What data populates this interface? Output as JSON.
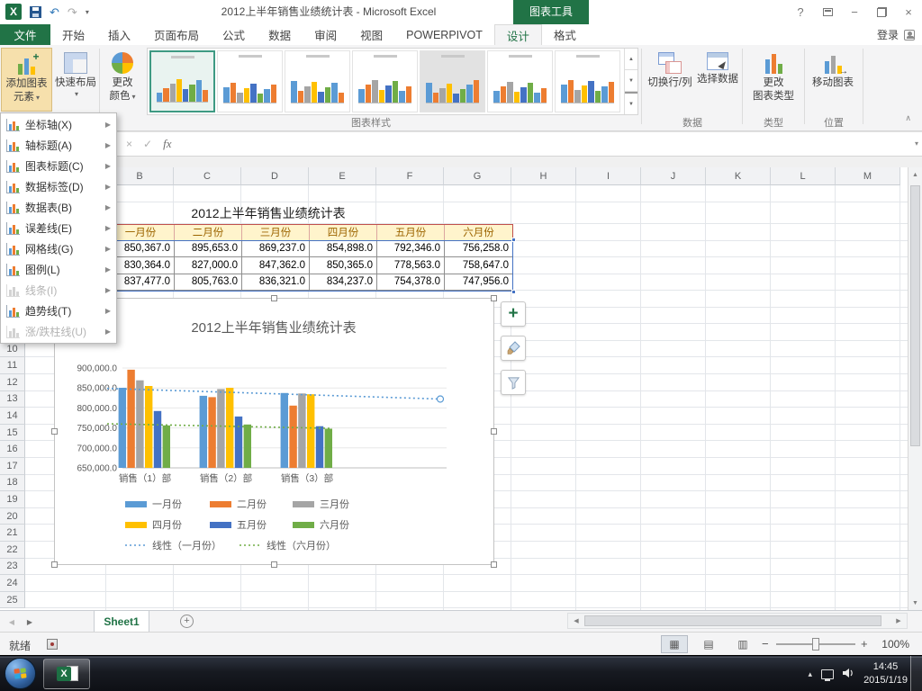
{
  "titlebar": {
    "app_title": "2012上半年销售业绩统计表 - Microsoft Excel",
    "context_tab_group": "图表工具"
  },
  "ribbon_tabs": {
    "file": "文件",
    "items": [
      "开始",
      "插入",
      "页面布局",
      "公式",
      "数据",
      "审阅",
      "视图",
      "POWERPIVOT",
      "设计",
      "格式"
    ],
    "active": "设计",
    "sign_in": "登录"
  },
  "ribbon": {
    "add_chart_element_line1": "添加图表",
    "add_chart_element_line2": "元素",
    "quick_layout": "快速布局",
    "change_colors_line1": "更改",
    "change_colors_line2": "颜色",
    "switch_row_col": "切换行/列",
    "select_data": "选择数据",
    "change_chart_type_line1": "更改",
    "change_chart_type_line2": "图表类型",
    "move_chart": "移动图表",
    "group_chart_styles": "图表样式",
    "group_data": "数据",
    "group_type": "类型",
    "group_position": "位置",
    "gallery": {
      "count": 7,
      "selected_index": 0
    }
  },
  "formula_bar": {
    "fx_label": "fx"
  },
  "menu": {
    "items": [
      {
        "label": "坐标轴(X)",
        "enabled": true,
        "icon": "axes-icon"
      },
      {
        "label": "轴标题(A)",
        "enabled": true,
        "icon": "axis-titles-icon"
      },
      {
        "label": "图表标题(C)",
        "enabled": true,
        "icon": "chart-title-icon"
      },
      {
        "label": "数据标签(D)",
        "enabled": true,
        "icon": "data-labels-icon"
      },
      {
        "label": "数据表(B)",
        "enabled": true,
        "icon": "data-table-icon"
      },
      {
        "label": "误差线(E)",
        "enabled": true,
        "icon": "error-bars-icon"
      },
      {
        "label": "网格线(G)",
        "enabled": true,
        "icon": "gridlines-icon"
      },
      {
        "label": "图例(L)",
        "enabled": true,
        "icon": "legend-icon"
      },
      {
        "label": "线条(I)",
        "enabled": false,
        "icon": "lines-icon"
      },
      {
        "label": "趋势线(T)",
        "enabled": true,
        "icon": "trendline-icon"
      },
      {
        "label": "涨/跌柱线(U)",
        "enabled": false,
        "icon": "updown-bars-icon"
      }
    ]
  },
  "sheet": {
    "columns": [
      "A",
      "B",
      "C",
      "D",
      "E",
      "F",
      "G",
      "H",
      "I",
      "J",
      "K",
      "L",
      "M"
    ],
    "row_count": 25,
    "table": {
      "title": "2012上半年销售业绩统计表",
      "month_headers": [
        "一月份",
        "二月份",
        "三月份",
        "四月份",
        "五月份",
        "六月份"
      ],
      "data_rows": [
        [
          "850,367.0",
          "895,653.0",
          "869,237.0",
          "854,898.0",
          "792,346.0",
          "756,258.0"
        ],
        [
          "830,364.0",
          "827,000.0",
          "847,362.0",
          "850,365.0",
          "778,563.0",
          "758,647.0"
        ],
        [
          "837,477.0",
          "805,763.0",
          "836,321.0",
          "834,237.0",
          "754,378.0",
          "747,956.0"
        ]
      ]
    }
  },
  "chart_data": {
    "type": "bar",
    "title": "2012上半年销售业绩统计表",
    "categories": [
      "销售（1）部",
      "销售（2）部",
      "销售（3）部"
    ],
    "series": [
      {
        "name": "一月份",
        "color": "#5B9BD5",
        "values": [
          850367,
          830364,
          837477
        ]
      },
      {
        "name": "二月份",
        "color": "#ED7D31",
        "values": [
          895653,
          827000,
          805763
        ]
      },
      {
        "name": "三月份",
        "color": "#A5A5A5",
        "values": [
          869237,
          847362,
          836321
        ]
      },
      {
        "name": "四月份",
        "color": "#FFC000",
        "values": [
          854898,
          850365,
          834237
        ]
      },
      {
        "name": "五月份",
        "color": "#4472C4",
        "values": [
          792346,
          778563,
          754378
        ]
      },
      {
        "name": "六月份",
        "color": "#70AD47",
        "values": [
          756258,
          758647,
          747956
        ]
      }
    ],
    "trendlines": [
      {
        "name": "线性（一月份）",
        "color": "#5B9BD5",
        "series": "一月份"
      },
      {
        "name": "线性（六月份）",
        "color": "#70AD47",
        "series": "六月份"
      }
    ],
    "y_ticks": [
      "900,000.0",
      "850,000.0",
      "800,000.0",
      "750,000.0",
      "700,000.0",
      "650,000.0"
    ],
    "ylim": [
      650000,
      900000
    ],
    "y_major_unit": 50000,
    "gridlines": true,
    "legend_position": "bottom"
  },
  "sheet_tabs": {
    "active_sheet": "Sheet1"
  },
  "status_bar": {
    "ready": "就绪",
    "zoom": "100%"
  },
  "taskbar": {
    "time": "14:45",
    "date": "2015/1/19"
  },
  "icons": {
    "dropdown_caret": "▾",
    "submenu_arrow": "▶",
    "scroll_left": "◀",
    "scroll_right": "▶",
    "scroll_up": "▲",
    "scroll_down": "▼",
    "gallery_up": "▲",
    "gallery_down": "▼",
    "gallery_more": "▼",
    "help": "?",
    "minimize": "−",
    "close": "×",
    "cancel": "×",
    "enter": "✓",
    "undo": "↶",
    "redo": "↷",
    "plus": "+",
    "new_sheet": "+",
    "zoom_out": "−",
    "zoom_in": "+",
    "collapse_ribbon": "∧",
    "tray_up": "▴",
    "view_normal": "▦",
    "view_layout": "▤",
    "view_break": "▥"
  }
}
